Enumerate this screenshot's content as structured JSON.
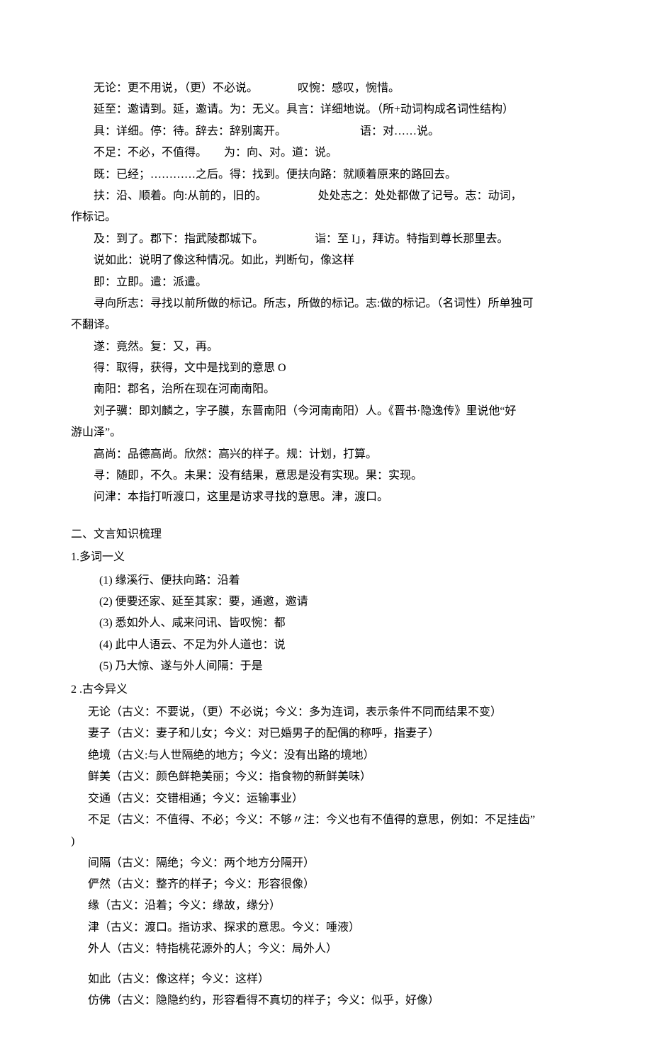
{
  "block1": {
    "lines": [
      "无论：更不用说，（更）不必说。　　　　叹惋：感叹，惋惜。",
      "延至：邀请到。延，邀请。为：无义。具言：详细地说。（所+动词构成名词性结构）",
      "具：详细。停：待。辞去：辞别离开。　　　　　　　语：对……说。",
      "不足：不必，不值得。　　为：向、对。道：说。",
      "既：已经；…………之后。得：找到。便扶向路：就顺着原来的路回去。",
      "扶：沿、顺着。向:从前的，旧的。　　　　　处处志之：处处都做了记号。志：动词，"
    ],
    "wrap1": "作标记。",
    "lines2": [
      "及：到了。郡下：指武陵郡城下。　　　　　诣：至 I」，拜访。特指到尊长那里去。",
      "说如此：说明了像这种情况。如此，判断句，像这样",
      "即：立即。遣：派遣。",
      "寻向所志：寻找以前所做的标记。所志，所做的标记。志:做的标记。（名词性）所单独可"
    ],
    "wrap2": "不翻译。",
    "lines3": [
      "遂：竟然。复：又，再。",
      "得：取得，获得，文中是找到的意思 O",
      "南阳：郡名，治所在现在河南南阳。",
      "刘子骥：即刘麟之，字子膜，东晋南阳（今河南南阳）人。《晋书·隐逸传》里说他“好"
    ],
    "wrap3": "游山泽”。",
    "lines4": [
      "高尚：品德高尚。欣然：高兴的样子。规：计划，打算。",
      "寻：随即，不久。未果：没有结果，意思是没有实现。果：实现。",
      "问津：本指打听渡口，这里是访求寻找的意思。津，渡口。"
    ]
  },
  "section2": {
    "title": "二、文言知识梳理",
    "sub1": {
      "title": "1.多词一义",
      "items": [
        "(1) 缘溪行、便扶向路：沿着",
        "(2) 便要还家、延至其家：要，通邀，邀请",
        "(3) 悉如外人、咸来问讯、皆叹惋：都",
        "(4) 此中人语云、不足为外人道也：说",
        "(5) 乃大惊、遂与外人间隔：于是"
      ]
    },
    "sub2": {
      "title": "2 .古今异义",
      "items": [
        "无论（古义：不要说，（更）不必说；今义：多为连词，表示条件不同而结果不变）",
        "妻子（古义：妻子和儿女；今义：对已婚男子的配偶的称呼，指妻子）",
        "绝境（古义:与人世隔绝的地方；今义：没有出路的境地）",
        "鲜美（古义：颜色鲜艳美丽；今义：指食物的新鲜美味）",
        "交通（古义：交错相通；今义：运输事业）",
        "不足（古义：不值得、不必；今义：不够〃注：今义也有不值得的意思，例如：不足挂齿”"
      ],
      "wrap": ")",
      "items2": [
        "间隔（古义：隔绝；今义：两个地方分隔开）",
        "俨然（古义：整齐的样子；今义：形容很像）",
        "缘（古义：沿着；今义：缘故，缘分）",
        "津（古义：渡口。指访求、探求的意思。今义：唾液）",
        "外人（古义：特指桃花源外的人；今义：局外人）"
      ],
      "items3": [
        "如此（古义：像这样；今义：这样）",
        "仿佛（古义：隐隐约约，形容看得不真切的样子；今义：似乎，好像）"
      ]
    }
  }
}
